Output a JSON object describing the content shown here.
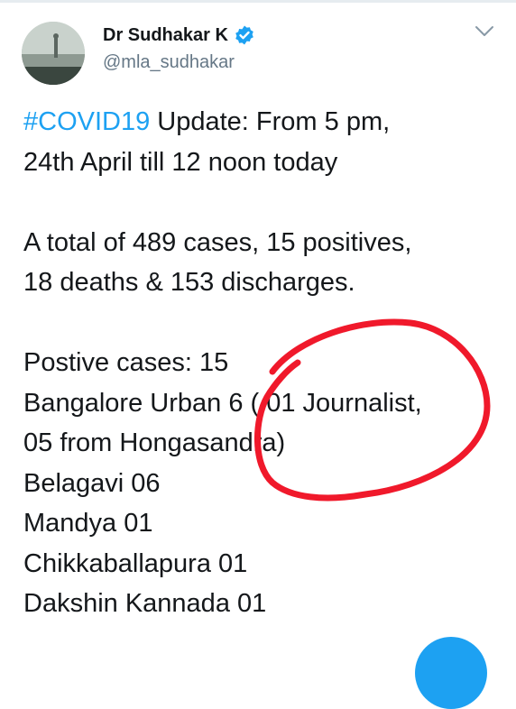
{
  "author": {
    "display_name": "Dr Sudhakar K",
    "handle": "@mla_sudhakar",
    "verified": true
  },
  "icons": {
    "verified": "verified-badge-icon",
    "more": "chevron-down-icon"
  },
  "colors": {
    "accent": "#1da1f2",
    "annotation": "#f0192b"
  },
  "tweet": {
    "hashtag": "#COVID19",
    "line1_rest": " Update: From 5 pm,",
    "line2": "24th April till 12 noon today",
    "line3": "A total of 489 cases, 15 positives,",
    "line4": "18 deaths & 153 discharges.",
    "line5": "Postive cases: 15",
    "line6": "Bangalore Urban 6 ( 01 Journalist,",
    "line7": "05 from Hongasandra)",
    "line8": "Belagavi 06",
    "line9": "Mandya 01",
    "line10": "Chikkaballapura 01",
    "line11": "Dakshin Kannada 01"
  }
}
